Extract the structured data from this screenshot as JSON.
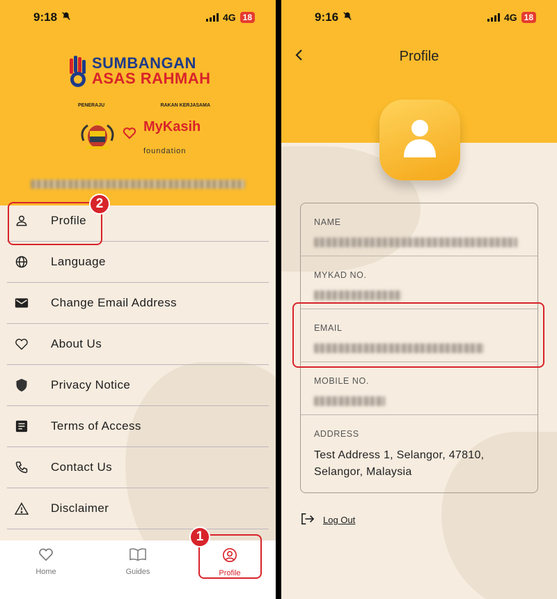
{
  "left_screen": {
    "status": {
      "time": "9:18",
      "network": "4G",
      "battery": "18"
    },
    "logo": {
      "line1": "SUMBANGAN",
      "line2": "ASAS RAHMAH"
    },
    "partners": {
      "peneraju_label": "PENERAJU",
      "rakan_label": "RAKAN KERJASAMA",
      "mykasih": "MyKasih",
      "foundation": "foundation"
    },
    "menu": [
      {
        "label": "Profile",
        "icon": "person-icon"
      },
      {
        "label": "Language",
        "icon": "globe-icon"
      },
      {
        "label": "Change Email Address",
        "icon": "mail-icon"
      },
      {
        "label": "About Us",
        "icon": "heart-icon"
      },
      {
        "label": "Privacy Notice",
        "icon": "shield-icon"
      },
      {
        "label": "Terms of Access",
        "icon": "document-icon"
      },
      {
        "label": "Contact Us",
        "icon": "phone-icon"
      },
      {
        "label": "Disclaimer",
        "icon": "warning-icon"
      }
    ],
    "tabs": [
      {
        "label": "Home",
        "icon": "heart-icon"
      },
      {
        "label": "Guides",
        "icon": "book-icon"
      },
      {
        "label": "Profile",
        "icon": "profile-circle-icon",
        "active": true
      }
    ],
    "badges": {
      "one": "1",
      "two": "2"
    }
  },
  "right_screen": {
    "status": {
      "time": "9:16",
      "network": "4G",
      "battery": "18"
    },
    "title": "Profile",
    "fields": {
      "name_label": "NAME",
      "mykad_label": "MYKAD NO.",
      "email_label": "EMAIL",
      "mobile_label": "MOBILE NO.",
      "address_label": "ADDRESS",
      "address_line1": "Test Address 1, Selangor, 47810,",
      "address_line2": "Selangor, Malaysia"
    },
    "logout_label": "Log Out"
  },
  "colors": {
    "accent_yellow": "#fbbb2c",
    "highlight_red": "#d8232a",
    "background": "#f6ecdf"
  }
}
